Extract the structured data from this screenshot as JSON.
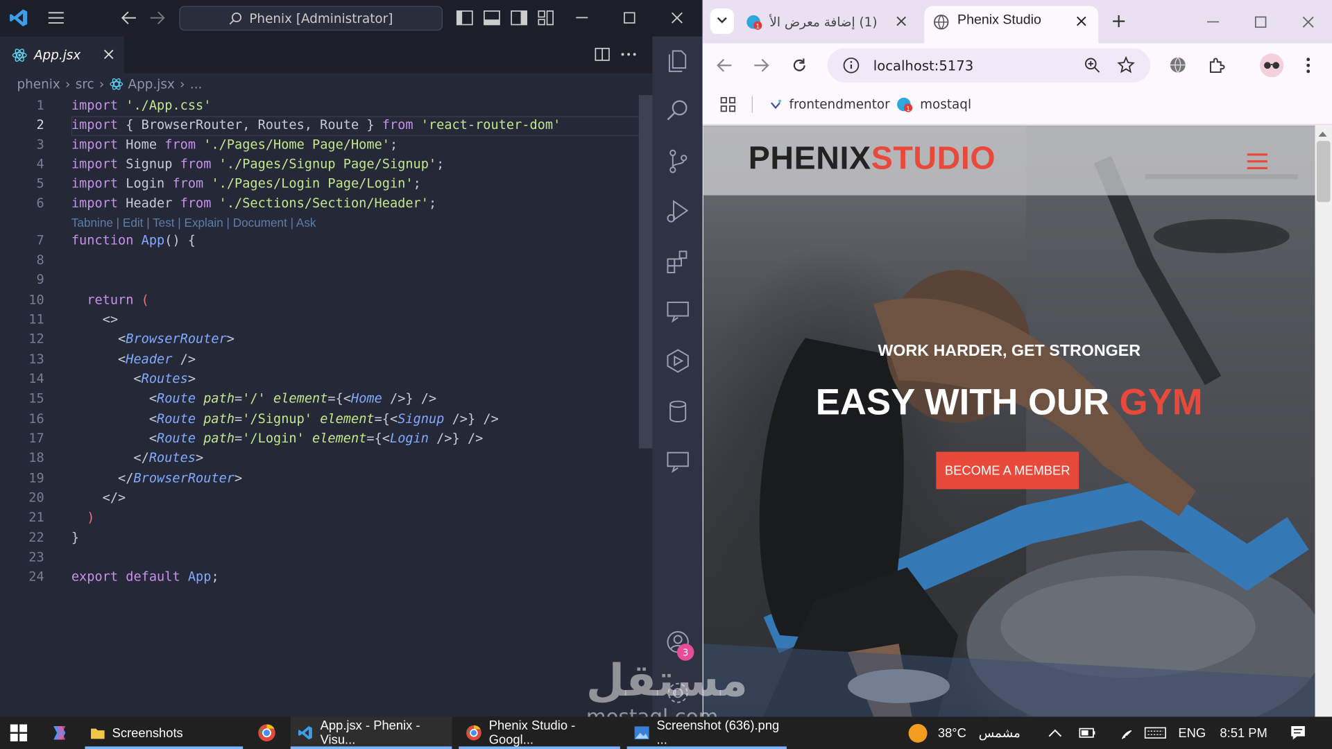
{
  "vscode": {
    "title": "Phenix [Administrator]",
    "tab": "App.jsx",
    "breadcrumb": [
      "phenix",
      "src",
      "App.jsx",
      "..."
    ],
    "codelens": "Tabnine | Edit | Test | Explain | Document | Ask",
    "line_numbers": [
      "1",
      "2",
      "3",
      "4",
      "5",
      "6",
      "7",
      "8",
      "9",
      "10",
      "11",
      "12",
      "13",
      "14",
      "15",
      "16",
      "17",
      "18",
      "19",
      "20",
      "21",
      "22",
      "23",
      "24"
    ],
    "account_badge": "3"
  },
  "chrome": {
    "tab_inactive": "(1) إضافة معرض الأ",
    "tab_active": "Phenix Studio",
    "url": "localhost:5173",
    "bookmarks": [
      "frontendmentor",
      "mostaql"
    ]
  },
  "site": {
    "brand_part1": "PHENIX",
    "brand_part2": "STUDIO",
    "kicker": "WORK HARDER, GET STRONGER",
    "headline_part1": "EASY WITH OUR ",
    "headline_part2": "GYM",
    "cta": "BECOME A MEMBER",
    "accent": "#e9493a"
  },
  "taskbar": {
    "items": [
      "Screenshots",
      "App.jsx - Phenix - Visu...",
      "Phenix Studio - Googl...",
      "Screenshot (636).png ..."
    ],
    "weather_temp": "38°C",
    "weather_text": "مشمس",
    "lang": "ENG",
    "time": "8:51 PM"
  },
  "watermark": {
    "line1": "مستقل",
    "line2": "mostaql.com"
  }
}
